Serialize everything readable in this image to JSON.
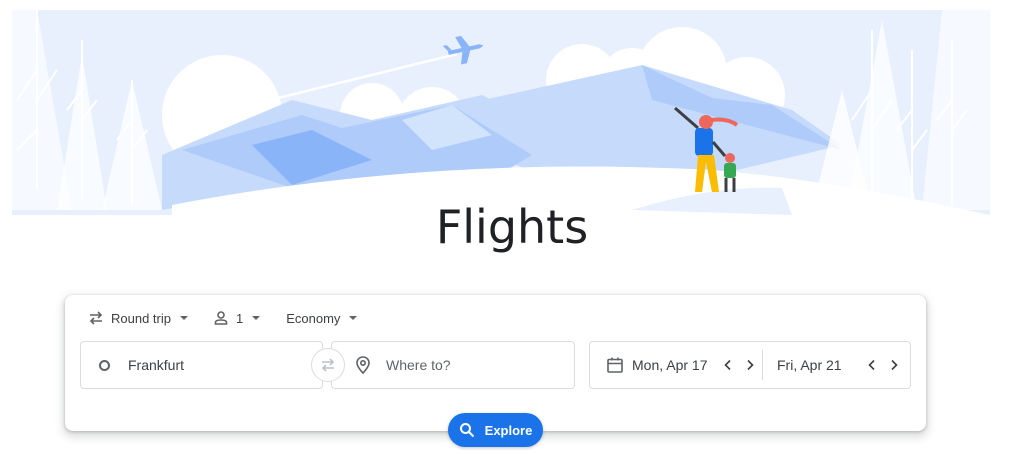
{
  "page": {
    "title": "Flights"
  },
  "options": {
    "trip_type": "Round trip",
    "passengers": "1",
    "cabin_class": "Economy"
  },
  "search": {
    "origin_value": "Frankfurt",
    "destination_placeholder": "Where to?",
    "departure_date": "Mon, Apr 17",
    "return_date": "Fri, Apr 21"
  },
  "actions": {
    "explore_label": "Explore"
  },
  "icons": {
    "trip_type": "swap-arrows-icon",
    "passengers": "person-icon",
    "origin": "ring-icon",
    "swap": "swap-arrows-icon",
    "destination": "location-pin-icon",
    "calendar": "calendar-icon",
    "explore": "search-icon"
  },
  "colors": {
    "accent": "#1a73e8",
    "illustration_blue": "#aecbfa",
    "illustration_light": "#e8f0fe"
  }
}
